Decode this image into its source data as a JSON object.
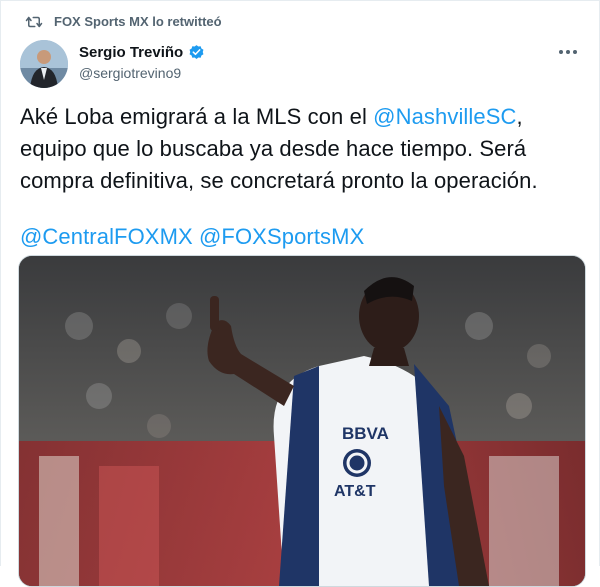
{
  "retweet": {
    "icon": "retweet-icon",
    "text": "FOX Sports MX lo retwitteó"
  },
  "author": {
    "name": "Sergio Treviño",
    "handle": "@sergiotrevino9",
    "verified_color": "#1d9bf0"
  },
  "tweet": {
    "line1_text": "Aké Loba emigrará a la MLS con el ",
    "line1_mention": "@NashvilleSC",
    "line1_tail": ",",
    "line2": "equipo que lo buscaba ya desde hace tiempo. Será",
    "line3": "compra definitiva, se concretará pronto la operación.",
    "mention1": "@CentralFOXMX",
    "mention2": "@FOXSportsMX"
  },
  "jersey": {
    "sponsor1": "BBVA",
    "sponsor2": "AT&T"
  },
  "colors": {
    "link": "#1d9bf0",
    "secondary_text": "#536471"
  }
}
